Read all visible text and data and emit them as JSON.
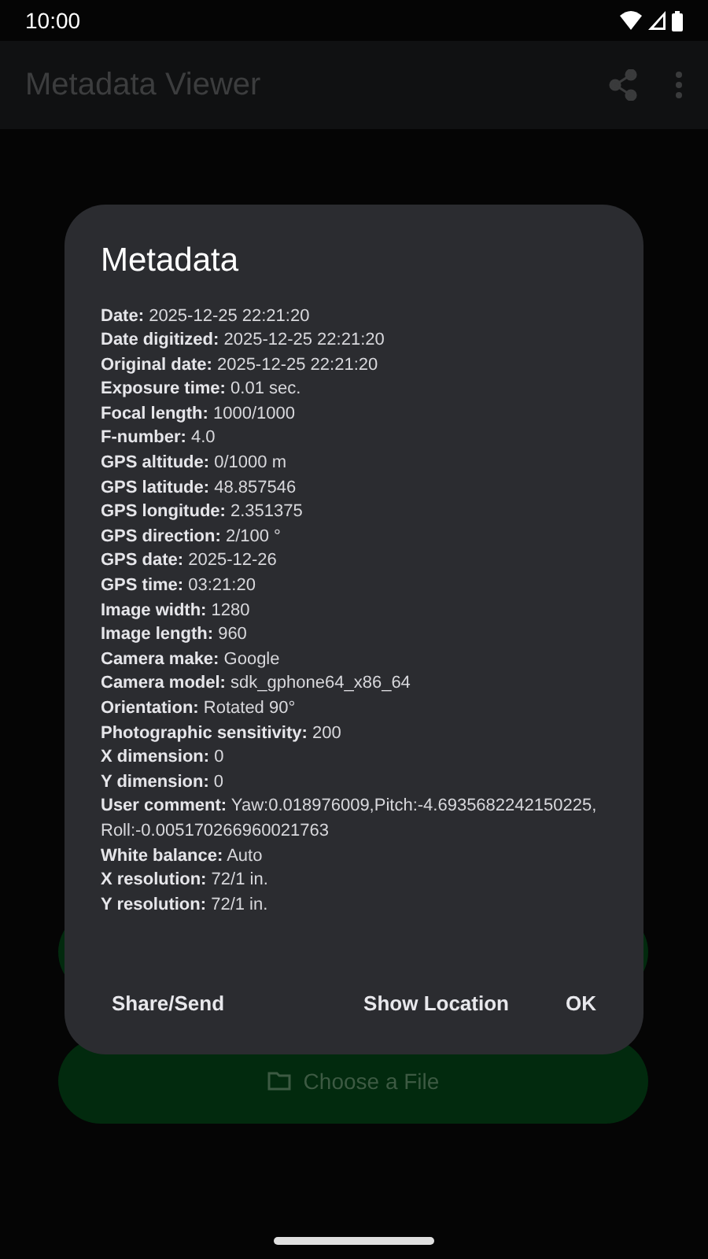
{
  "status_bar": {
    "time": "10:00"
  },
  "app_bar": {
    "title": "Metadata Viewer"
  },
  "background_buttons": [
    {
      "kind": "plain"
    },
    {
      "kind": "file",
      "label": "Choose a File"
    }
  ],
  "dialog": {
    "title": "Metadata",
    "rows": [
      "**Date:** 2025-12-25 22:21:20",
      "**Date digitized:** 2025-12-25 22:21:20",
      "**Original date:** 2025-12-25 22:21:20",
      "**Exposure time:** 0.01 sec.",
      "**Focal length:** 1000/1000",
      "**F-number:** 4.0",
      "**GPS altitude:** 0/1000 m",
      "**GPS latitude:** 48.857546",
      "**GPS longitude:** 2.351375",
      "**GPS direction:** 2/100 °",
      "**GPS date:** 2025-12-26",
      "**GPS time:** 03:21:20",
      "**Image width:** 1280",
      "**Image length:** 960",
      "**Camera make:** Google",
      "**Camera model:** sdk_gphone64_x86_64",
      "**Orientation:** Rotated 90°",
      "**Photographic sensitivity:** 200",
      "**X dimension:** 0",
      "**Y dimension:** 0",
      "**User comment:** Yaw:0.018976009,Pitch:-4.6935682242150225,Roll:-0.005170266960021763",
      "**White balance:** Auto",
      "**X resolution:** 72/1 in.",
      "**Y resolution:** 72/1 in."
    ],
    "buttons": [
      "Share/Send",
      "Show Location",
      "OK"
    ]
  }
}
